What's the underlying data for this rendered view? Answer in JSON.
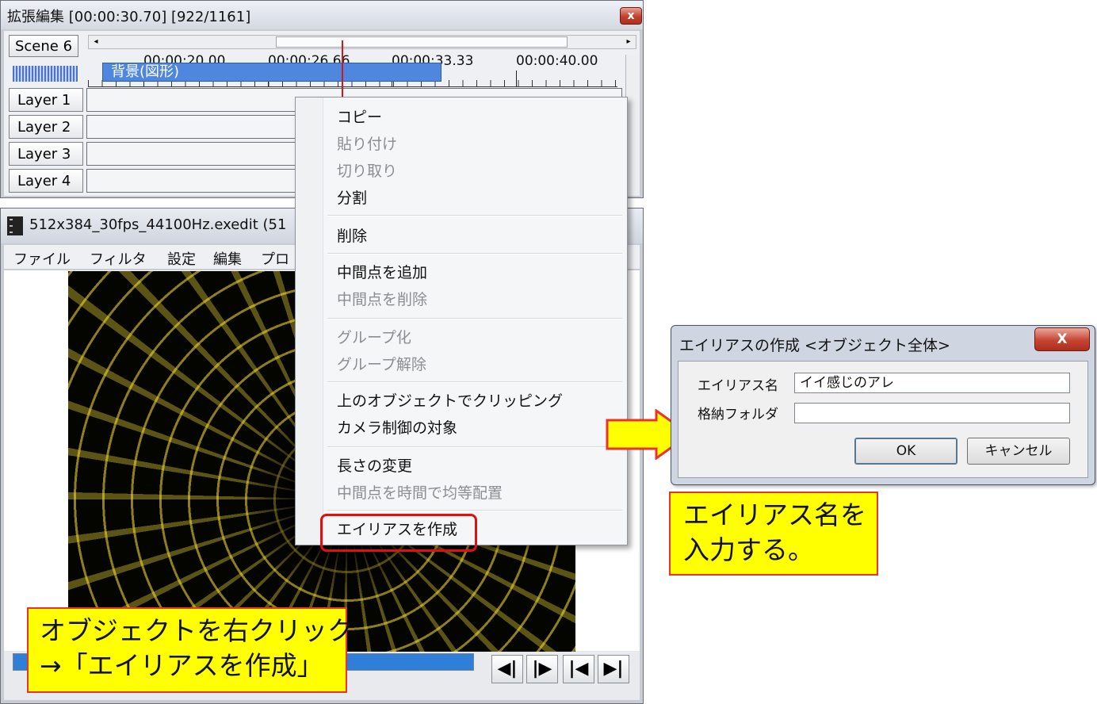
{
  "timeline": {
    "title": "拡張編集 [00:00:30.70] [922/1161]",
    "close_glyph": "x",
    "scene": "Scene 6",
    "scroll_left": "◂",
    "scroll_right": "▸",
    "time_labels": [
      "00:00:20.00",
      "00:00:26.66",
      "00:00:33.33",
      "00:00:40.00"
    ],
    "layers": [
      "Layer  1",
      "Layer  2",
      "Layer  3",
      "Layer  4"
    ],
    "clip_label": "背景(図形)"
  },
  "main_window": {
    "title": "512x384_30fps_44100Hz.exedit (51",
    "menu": [
      "ファイル",
      "フィルタ",
      "設定",
      "編集",
      "プロ"
    ],
    "nav_buttons": [
      "◀|",
      "|▶",
      "|◀",
      "▶|"
    ]
  },
  "context_menu": {
    "items": [
      {
        "label": "コピー",
        "enabled": true
      },
      {
        "label": "貼り付け",
        "enabled": false
      },
      {
        "label": "切り取り",
        "enabled": false
      },
      {
        "label": "分割",
        "enabled": true
      },
      {
        "label": "削除",
        "enabled": true
      },
      {
        "label": "中間点を追加",
        "enabled": true
      },
      {
        "label": "中間点を削除",
        "enabled": false
      },
      {
        "label": "グループ化",
        "enabled": false
      },
      {
        "label": "グループ解除",
        "enabled": false
      },
      {
        "label": "上のオブジェクトでクリッピング",
        "enabled": true
      },
      {
        "label": "カメラ制御の対象",
        "enabled": true
      },
      {
        "label": "長さの変更",
        "enabled": true
      },
      {
        "label": "中間点を時間で均等配置",
        "enabled": false
      },
      {
        "label": "エイリアスを作成",
        "enabled": true
      }
    ]
  },
  "callouts": {
    "left_line1": "オブジェクトを右クリック",
    "left_line2": "→「エイリアスを作成」",
    "right_line1": "エイリアス名を",
    "right_line2": "入力する。"
  },
  "dialog": {
    "title": "エイリアスの作成 <オブジェクト全体>",
    "close_glyph": "X",
    "alias_name_label": "エイリアス名",
    "alias_name_value": "イイ感じのアレ",
    "folder_label": "格納フォルダ",
    "folder_value": "",
    "ok_label": "OK",
    "cancel_label": "キャンセル"
  },
  "colors": {
    "callout_bg": "#ffff00",
    "callout_border": "#e8342a",
    "highlight": "#e01010",
    "clip": "#4f86de",
    "playhead": "#d01818"
  }
}
